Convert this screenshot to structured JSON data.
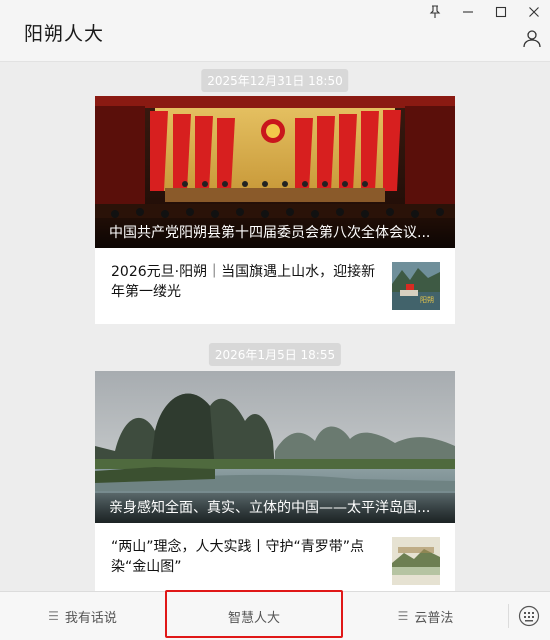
{
  "app": {
    "title": "阳朔人大"
  },
  "window_controls": [
    {
      "name": "pin-icon"
    },
    {
      "name": "minimize-icon"
    },
    {
      "name": "maximize-icon"
    },
    {
      "name": "close-icon"
    }
  ],
  "feed": [
    {
      "timestamp": "2025年12月31日 18:50",
      "cover_title": "中国共产党阳朔县第十四届委员会第八次全体会议...",
      "cover_image": "conference-hall-photo",
      "items": [
        {
          "title": "2026元旦·阳朔｜当国旗遇上山水，迎接新年第一缕光",
          "thumb": "river-flag-thumbnail"
        }
      ]
    },
    {
      "timestamp": "2026年1月5日 18:55",
      "cover_title": "亲身感知全面、真实、立体的中国——太平洋岛国...",
      "cover_image": "karst-mountains-river-photo",
      "items": [
        {
          "title": "“两山”理念，人大实践丨守护“青罗带”点染“金山图”",
          "thumb": "landscape-thumbnail"
        }
      ]
    }
  ],
  "bottom_menu": {
    "items": [
      {
        "label": "我有话说",
        "has_submenu": true
      },
      {
        "label": "智慧人大",
        "has_submenu": false
      },
      {
        "label": "云普法",
        "has_submenu": true
      }
    ],
    "highlighted": "智慧人大",
    "highlight_color": "#e01818"
  },
  "colors": {
    "timestamp_bg": "#d8d8d8",
    "page_bg": "#ededed"
  }
}
